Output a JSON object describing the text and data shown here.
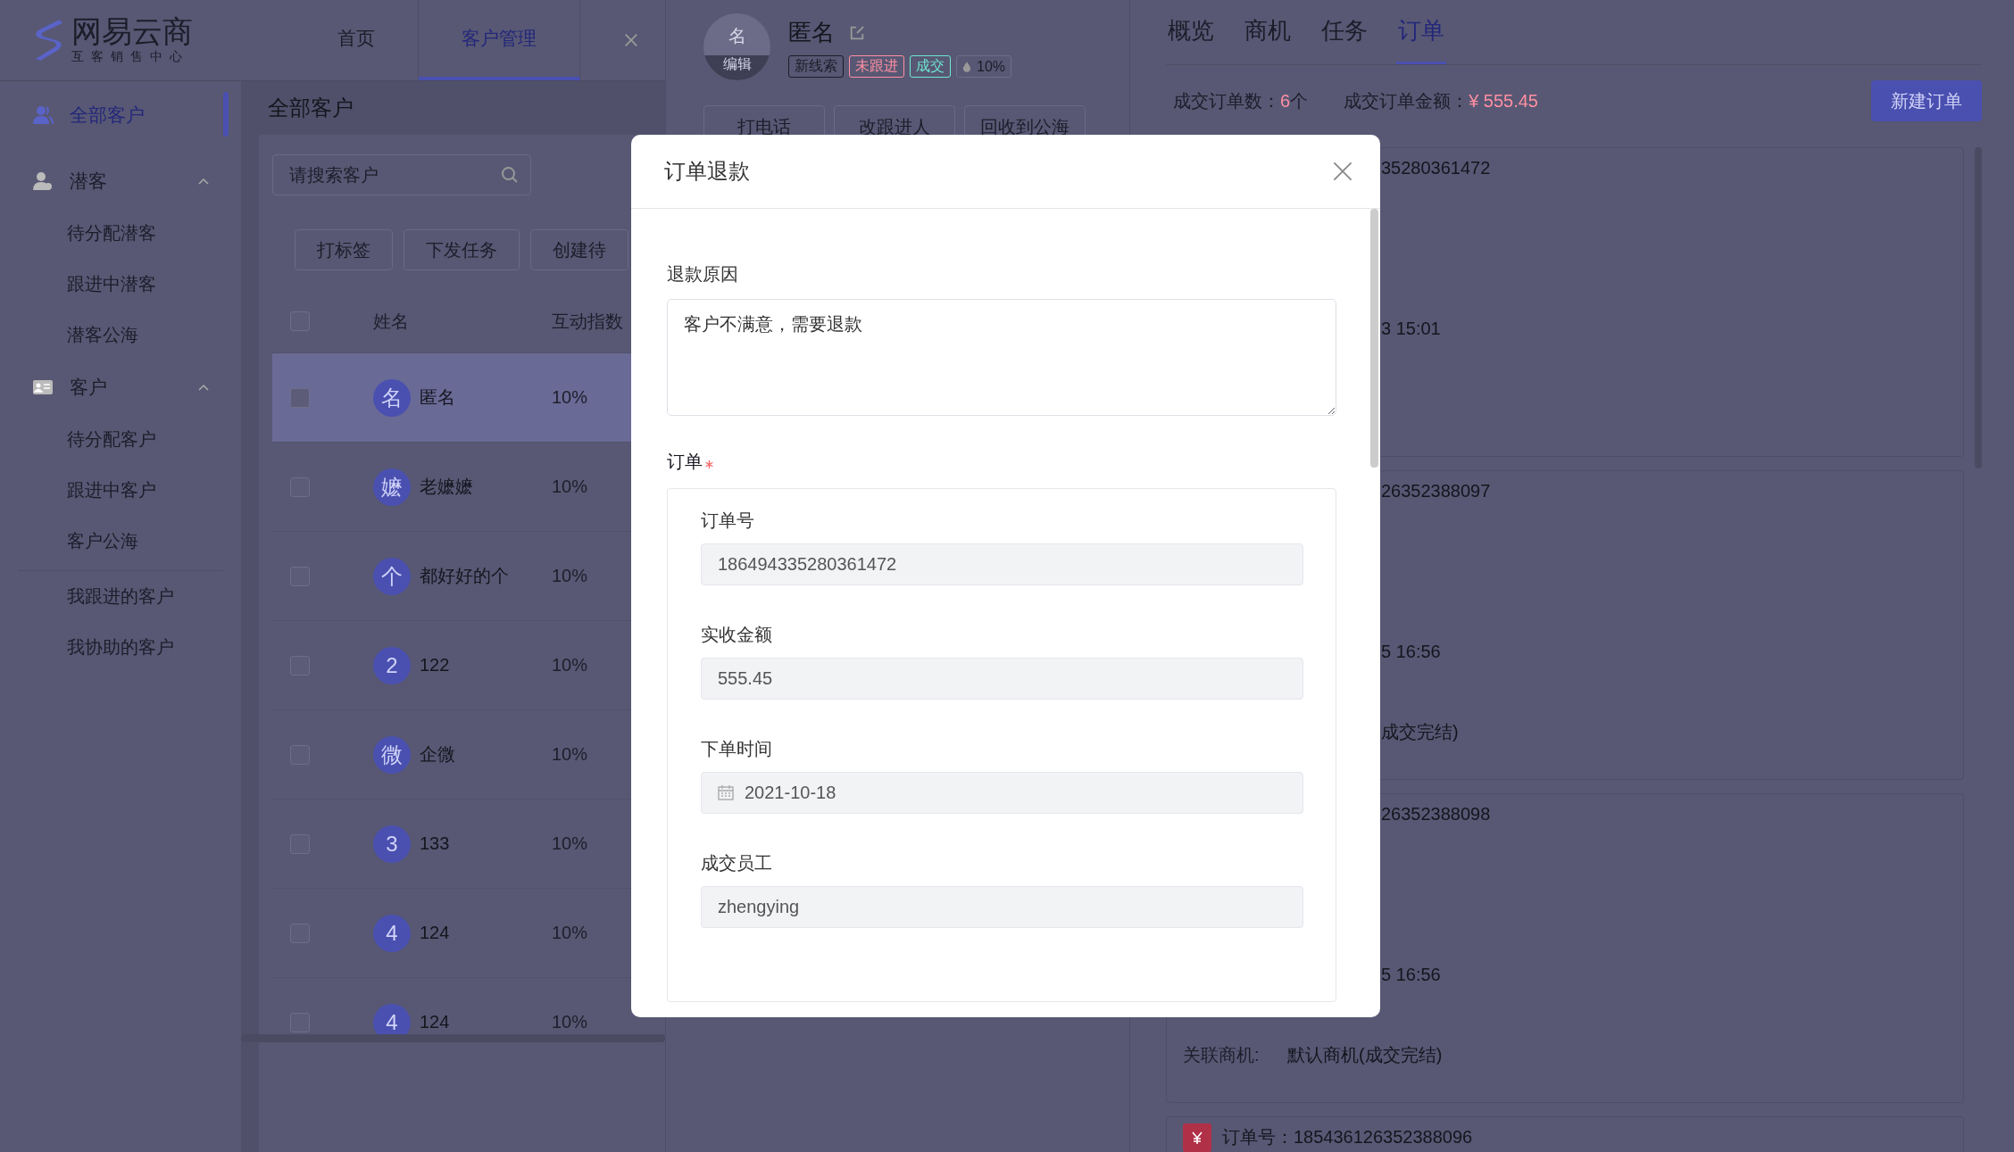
{
  "app_header": {
    "logo": {
      "name": "网易云商",
      "subtitle": "互客销售中心"
    },
    "tabs": [
      {
        "label": "首页",
        "selected": false
      },
      {
        "label": "客户管理",
        "selected": true
      }
    ]
  },
  "sidebar": {
    "items": [
      {
        "kind": "top",
        "label": "全部客户",
        "selected": true
      },
      {
        "kind": "group",
        "label": "潜客",
        "expanded": true,
        "children": [
          {
            "label": "待分配潜客",
            "selected": false
          },
          {
            "label": "跟进中潜客",
            "selected": false
          },
          {
            "label": "潜客公海",
            "selected": false
          }
        ]
      },
      {
        "kind": "group",
        "label": "客户",
        "expanded": true,
        "children": [
          {
            "label": "待分配客户",
            "selected": false
          },
          {
            "label": "跟进中客户",
            "selected": false
          },
          {
            "label": "客户公海",
            "selected": false
          }
        ]
      },
      {
        "kind": "plain",
        "label": "我跟进的客户",
        "selected": false
      },
      {
        "kind": "plain",
        "label": "我协助的客户",
        "selected": false
      }
    ]
  },
  "list_panel": {
    "title": "全部客户",
    "search": {
      "placeholder": "请搜索客户"
    },
    "actions": [
      "打标签",
      "下发任务",
      "创建待"
    ],
    "select_all": {
      "checked": false
    },
    "columns": [
      "姓名",
      "互动指数"
    ],
    "rows": [
      {
        "avatar": "名",
        "name": "匿名",
        "score": "10%",
        "selected": true,
        "checked": false
      },
      {
        "avatar": "嬷",
        "name": "老嬷嬷",
        "score": "10%",
        "selected": false,
        "checked": false
      },
      {
        "avatar": "个",
        "name": "都好好的个",
        "score": "10%",
        "selected": false,
        "checked": false
      },
      {
        "avatar": "2",
        "name": "122",
        "score": "10%",
        "selected": false,
        "checked": false
      },
      {
        "avatar": "微",
        "name": "企微",
        "score": "10%",
        "selected": false,
        "checked": false
      },
      {
        "avatar": "3",
        "name": "133",
        "score": "10%",
        "selected": false,
        "checked": false
      },
      {
        "avatar": "4",
        "name": "124",
        "score": "10%",
        "selected": false,
        "checked": false
      },
      {
        "avatar": "4",
        "name": "124",
        "score": "10%",
        "selected": false,
        "checked": false
      }
    ]
  },
  "profile": {
    "avatar": {
      "initial": "名",
      "edit_label": "编辑"
    },
    "name": "匿名",
    "tags": [
      {
        "label": "新线索",
        "color": "#1c1c2a"
      },
      {
        "label": "未跟进",
        "color": "#ff8fa2"
      },
      {
        "label": "成交",
        "color": "#6ee8d2"
      }
    ],
    "score": "10%",
    "actions": [
      "打电话",
      "改跟进人",
      "回收到公海"
    ]
  },
  "detail": {
    "tabs": [
      {
        "label": "概览",
        "selected": false
      },
      {
        "label": "商机",
        "selected": false
      },
      {
        "label": "任务",
        "selected": false
      },
      {
        "label": "订单",
        "selected": true
      }
    ],
    "summary": [
      {
        "label": "成交订单数：",
        "value": "6",
        "unit": "个"
      },
      {
        "label": "成交订单金额：",
        "value": "¥ 555.45"
      }
    ],
    "new_order_button": "新建订单",
    "orders": [
      {
        "items": [
          {
            "kind": "order_no",
            "text": "35280361472"
          },
          {
            "kind": "time",
            "text": "3 15:01"
          }
        ]
      },
      {
        "items": [
          {
            "kind": "order_no",
            "text": "26352388097"
          },
          {
            "kind": "time",
            "text": "5 16:56"
          },
          {
            "kind": "link",
            "text": "成交完结)"
          }
        ]
      },
      {
        "items": [
          {
            "kind": "order_no",
            "text": "26352388098"
          },
          {
            "kind": "time",
            "text": "5 16:56"
          },
          {
            "kind": "link",
            "label": "关联商机:",
            "value": "默认商机(成交完结)"
          }
        ]
      },
      {
        "items": [
          {
            "kind": "order_no",
            "label": "订单号：",
            "value": "185436126352388096"
          }
        ]
      }
    ]
  },
  "dialog": {
    "title": "订单退款",
    "reason": {
      "label": "退款原因",
      "value": "客户不满意，需要退款"
    },
    "order_section": {
      "label": "订单",
      "required": true,
      "fields": [
        {
          "kind": "text",
          "label": "订单号",
          "value": "186494335280361472",
          "disabled": true
        },
        {
          "kind": "text",
          "label": "实收金额",
          "value": "555.45",
          "disabled": true
        },
        {
          "kind": "date",
          "label": "下单时间",
          "value": "2021-10-18",
          "disabled": true
        },
        {
          "kind": "text",
          "label": "成交员工",
          "value": "zhengying",
          "disabled": true
        }
      ]
    }
  }
}
